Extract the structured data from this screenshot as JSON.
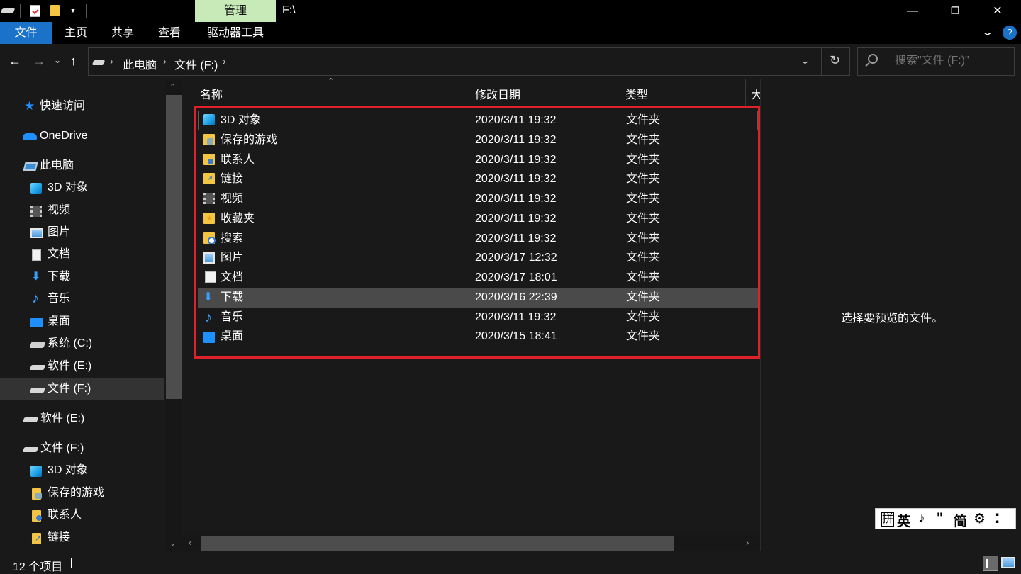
{
  "window": {
    "title": "F:\\",
    "contextual_tab": "管理",
    "minimize": "—",
    "maximize": "❐",
    "close": "✕"
  },
  "ribbon": {
    "tabs": [
      "文件",
      "主页",
      "共享",
      "查看",
      "驱动器工具"
    ],
    "help": "?"
  },
  "address": {
    "crumbs": [
      "此电脑",
      "文件 (F:)"
    ],
    "search_placeholder": "搜索\"文件 (F:)\""
  },
  "nav": {
    "quick_access": "快速访问",
    "onedrive": "OneDrive",
    "this_pc": "此电脑",
    "pc_items": [
      "3D 对象",
      "视频",
      "图片",
      "文档",
      "下载",
      "音乐",
      "桌面",
      "系统 (C:)",
      "软件 (E:)",
      "文件 (F:)"
    ],
    "drive_e": "软件 (E:)",
    "drive_f": "文件 (F:)",
    "f_items": [
      "3D 对象",
      "保存的游戏",
      "联系人",
      "链接"
    ]
  },
  "columns": {
    "name": "名称",
    "date": "修改日期",
    "type": "类型",
    "size": "大"
  },
  "files": [
    {
      "name": "3D 对象",
      "date": "2020/3/11 19:32",
      "type": "文件夹",
      "icon": "3d-objects-icon"
    },
    {
      "name": "保存的游戏",
      "date": "2020/3/11 19:32",
      "type": "文件夹",
      "icon": "saved-games-icon"
    },
    {
      "name": "联系人",
      "date": "2020/3/11 19:32",
      "type": "文件夹",
      "icon": "contacts-icon"
    },
    {
      "name": "链接",
      "date": "2020/3/11 19:32",
      "type": "文件夹",
      "icon": "links-icon"
    },
    {
      "name": "视频",
      "date": "2020/3/11 19:32",
      "type": "文件夹",
      "icon": "videos-icon"
    },
    {
      "name": "收藏夹",
      "date": "2020/3/11 19:32",
      "type": "文件夹",
      "icon": "favorites-icon"
    },
    {
      "name": "搜索",
      "date": "2020/3/11 19:32",
      "type": "文件夹",
      "icon": "searches-icon"
    },
    {
      "name": "图片",
      "date": "2020/3/17 12:32",
      "type": "文件夹",
      "icon": "pictures-icon"
    },
    {
      "name": "文档",
      "date": "2020/3/17 18:01",
      "type": "文件夹",
      "icon": "documents-icon"
    },
    {
      "name": "下载",
      "date": "2020/3/16 22:39",
      "type": "文件夹",
      "icon": "downloads-icon"
    },
    {
      "name": "音乐",
      "date": "2020/3/11 19:32",
      "type": "文件夹",
      "icon": "music-icon"
    },
    {
      "name": "桌面",
      "date": "2020/3/15 18:41",
      "type": "文件夹",
      "icon": "desktop-icon"
    }
  ],
  "preview": {
    "empty_text": "选择要预览的文件。"
  },
  "ime": [
    "拼",
    "英",
    "♪",
    "\"",
    "简",
    "⚙",
    "⁚"
  ],
  "status": {
    "item_count": "12 个项目"
  },
  "colors": {
    "accent": "#1a73c9",
    "manage_tab": "#c7eab8",
    "highlight_border": "#e0202a"
  }
}
